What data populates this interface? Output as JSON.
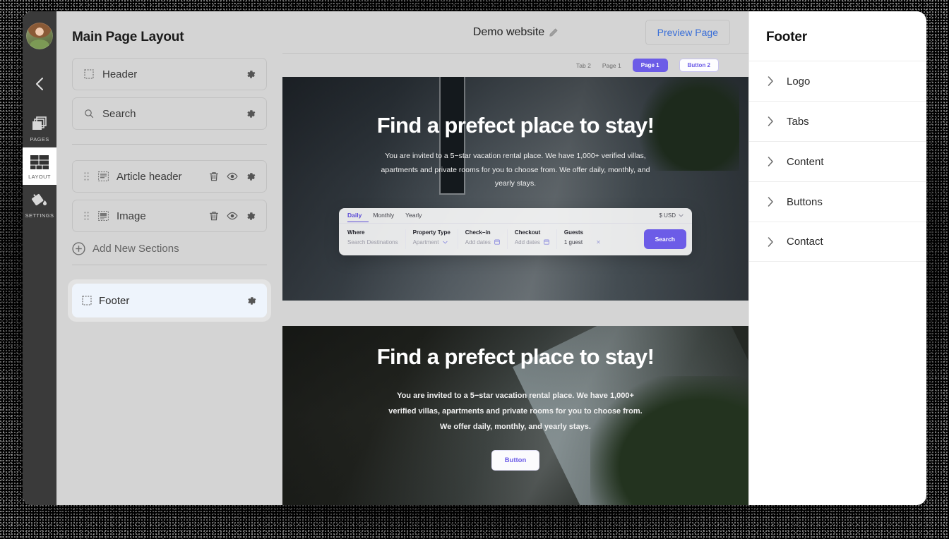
{
  "rail": {
    "avatar_name": "user-avatar",
    "back_label": "back",
    "items": [
      {
        "label": "PAGES",
        "icon": "pages-icon",
        "active": false
      },
      {
        "label": "LAYOUT",
        "icon": "layout-icon",
        "active": true
      },
      {
        "label": "SETTINGS",
        "icon": "paint-bucket-icon",
        "active": false
      }
    ]
  },
  "layout_panel": {
    "title": "Main Page Layout",
    "top_sections": [
      {
        "label": "Header",
        "icon": "dashed-box-icon"
      },
      {
        "label": "Search",
        "icon": "search-icon"
      }
    ],
    "body_sections": [
      {
        "label": "Article header",
        "icon": "article-icon"
      },
      {
        "label": "Image",
        "icon": "image-icon"
      }
    ],
    "add_label": "Add New Sections",
    "footer_section": {
      "label": "Footer",
      "icon": "dashed-box-icon"
    }
  },
  "preview": {
    "site_title": "Demo website",
    "edit_icon": "pencil-icon",
    "preview_button": "Preview Page",
    "nav": {
      "links": [
        "Tab 2",
        "Page 1"
      ],
      "primary_button": "Page 1",
      "secondary_button": "Button 2"
    },
    "hero1": {
      "heading": "Find a prefect place to stay!",
      "paragraph": "You are invited to a 5−star vacation rental place. We have 1,000+ verified villas, apartments and private rooms for you to choose from. We offer daily, monthly, and yearly stays."
    },
    "hero2": {
      "heading": "Find a prefect place to stay!",
      "paragraph": "You are invited to a 5−star vacation rental place. We have 1,000+ verified villas, apartments and private rooms for you to choose from. We offer daily, monthly, and yearly stays.",
      "button": "Button"
    },
    "search_widget": {
      "tabs": [
        "Daily",
        "Monthly",
        "Yearly"
      ],
      "active_tab": "Daily",
      "currency": "$ USD",
      "fields": [
        {
          "label": "Where",
          "value": "Search Destinations"
        },
        {
          "label": "Property Type",
          "value": "Apartment"
        },
        {
          "label": "Check−in",
          "value": "Add dates"
        },
        {
          "label": "Checkout",
          "value": "Add dates"
        },
        {
          "label": "Guests",
          "value": "1 guest"
        }
      ],
      "search_button": "Search"
    }
  },
  "right_panel": {
    "title": "Footer",
    "items": [
      "Logo",
      "Tabs",
      "Content",
      "Buttons",
      "Contact"
    ]
  },
  "colors": {
    "accent_purple": "#6c5ce7",
    "link_blue": "#3a6fd8",
    "panel_grey": "#d4d4d4",
    "selected_blue": "#eef4fc"
  }
}
